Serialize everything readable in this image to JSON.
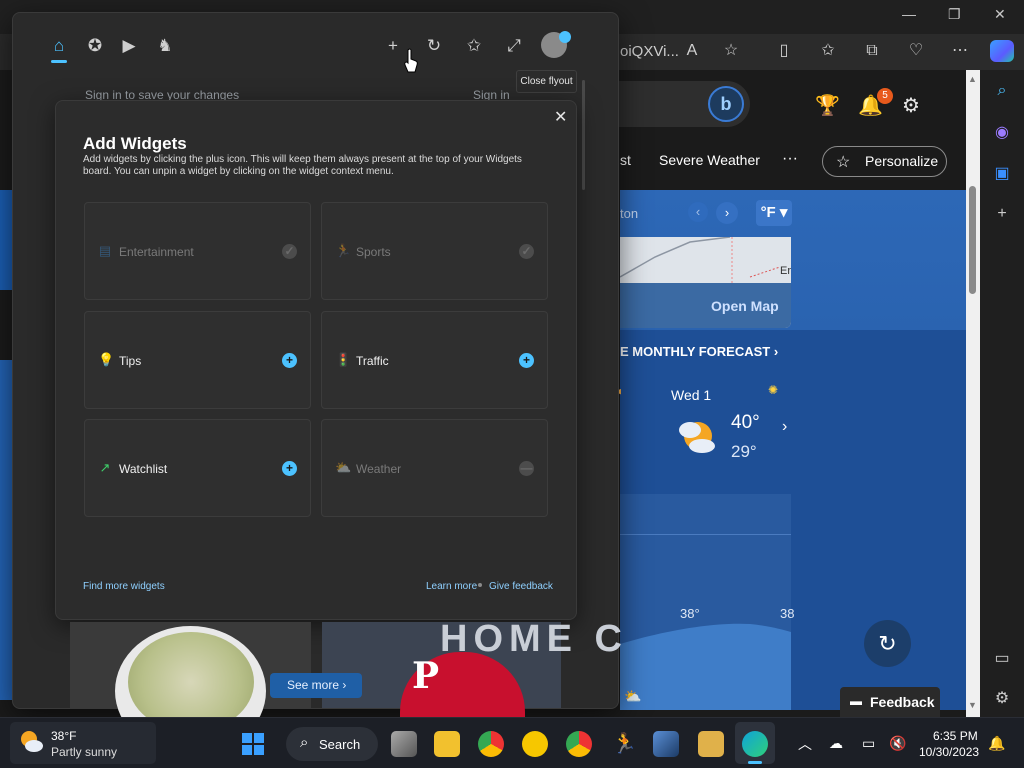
{
  "browser": {
    "window_controls": {
      "minimize": "—",
      "restore": "❐",
      "close": "✕"
    },
    "address_fragment": "oiQXVi...",
    "toolbar_icons": [
      "read-aloud-icon",
      "favorite-star-icon",
      "split-screen-icon",
      "favorites-icon",
      "collections-icon",
      "performance-icon",
      "more-icon",
      "copilot-icon"
    ]
  },
  "page": {
    "header": {
      "notification_count": "5"
    },
    "nav": {
      "fragment": "st",
      "severe_weather": "Severe Weather",
      "more": "···",
      "personalize": "Personalize"
    },
    "weather": {
      "location_fragment": "ton",
      "unit": "°F ▾",
      "open_map": "Open Map",
      "map_label": "Er",
      "monthly_forecast": "E MONTHLY FORECAST ›",
      "forecast_day": "Wed 1",
      "forecast_high": "40°",
      "forecast_low": "29°",
      "chart_temp_a": "38°",
      "chart_temp_b": "38"
    },
    "feedback": "Feedback"
  },
  "flyout": {
    "tooltip": "Close flyout",
    "signin_text": "Sign in to save your changes",
    "signin_link": "Sign in"
  },
  "dialog": {
    "title": "Add Widgets",
    "description": "Add widgets by clicking the plus icon. This will keep them always present at the top of your Widgets board. You can unpin a widget by clicking on the widget context menu.",
    "cards": [
      {
        "label": "Entertainment",
        "icon": "entertainment-icon",
        "state": "added",
        "button": "✓"
      },
      {
        "label": "Sports",
        "icon": "sports-icon",
        "state": "added",
        "button": "✓"
      },
      {
        "label": "Tips",
        "icon": "tips-icon",
        "state": "available",
        "button": "+"
      },
      {
        "label": "Traffic",
        "icon": "traffic-icon",
        "state": "available",
        "button": "+"
      },
      {
        "label": "Watchlist",
        "icon": "watchlist-icon",
        "state": "available",
        "button": "+"
      },
      {
        "label": "Weather",
        "icon": "weather-icon",
        "state": "added",
        "button": "—"
      }
    ],
    "find_more": "Find more widgets",
    "learn_more": "Learn more",
    "give_feedback": "Give feedback",
    "close": "✕"
  },
  "feed": {
    "see_more": "See more ›",
    "cap_text": "HOME C",
    "cap_letter": "P"
  },
  "taskbar": {
    "weather_temp": "38°F",
    "weather_cond": "Partly sunny",
    "search_label": "Search",
    "clock_time": "6:35 PM",
    "clock_date": "10/30/2023"
  },
  "colors": {
    "accent": "#4cc2ff",
    "weather_blue": "#1e4f96",
    "badge_orange": "#e85a1c"
  }
}
